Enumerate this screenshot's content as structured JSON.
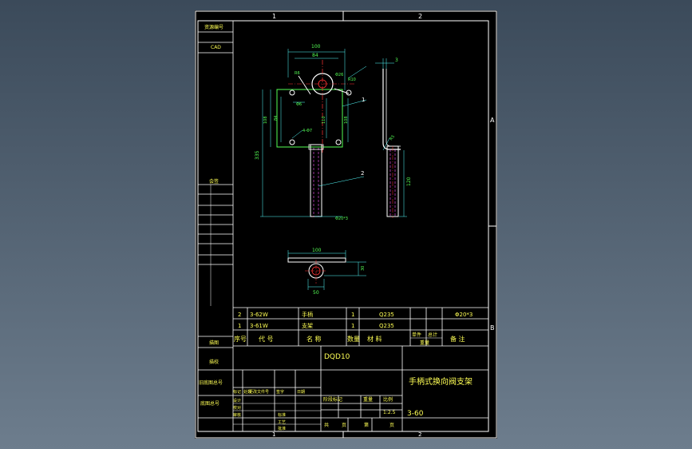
{
  "frame": {
    "zone_top": [
      "1",
      "2"
    ],
    "zone_bottom": [
      "1",
      "2"
    ],
    "zone_right": [
      "A",
      "B"
    ]
  },
  "side_table": {
    "top_cells": [
      "资源编号",
      "CAD"
    ],
    "mid_cell": "会签",
    "low_cells": [
      "描图",
      "描校",
      "旧底图总号",
      "底图总号"
    ]
  },
  "parts_list": {
    "rows": [
      {
        "no": "2",
        "code": "3-62W",
        "name": "手柄",
        "qty": "1",
        "material": "Q235",
        "note": "Φ20*3"
      },
      {
        "no": "1",
        "code": "3-61W",
        "name": "支架",
        "qty": "1",
        "material": "Q235",
        "note": ""
      }
    ],
    "header": [
      "序号",
      "代    号",
      "名    称",
      "数量",
      "材    料",
      "单件",
      "总计",
      "重量",
      "备    注"
    ]
  },
  "title_block": {
    "drawing_no": "DQD10",
    "title": "手柄式换向阀支架",
    "scale": "1:2.5",
    "sheet_code": "3-60",
    "stage_label": "阶段标记",
    "weight_label": "重量",
    "scale_label": "比例",
    "total_label": "共",
    "page_label": "页",
    "sheet_label": "第",
    "change_labels": [
      "标记",
      "处数",
      "更改文件号",
      "签字",
      "日期"
    ],
    "role_labels": [
      "设计",
      "校对",
      "审核",
      "标准",
      "批准"
    ],
    "designer_label": "工艺"
  },
  "dims": {
    "front_width": "100",
    "front_inner": "84",
    "hole_dia": "R10",
    "hole_top": "R6",
    "top_dia": "Φ26",
    "center": "Φ6",
    "h_total": "335",
    "h_body": "108",
    "h_inner": "84",
    "h_right": "110",
    "h_right2": "108",
    "slot": "4-Φ7",
    "rod_dia": "Φ20*3",
    "side_thk": "3",
    "side_r": "R5",
    "side_len": "120",
    "bottom_w": "100",
    "bottom_h": "30",
    "bottom_d": "50",
    "leader_1": "1",
    "leader_2": "2"
  },
  "colors": {
    "frame": "#ffffff",
    "part_line": "#55ff55",
    "dim_line": "#55ffff",
    "center_line": "#ff3333",
    "hatch": "#ff55ff"
  }
}
